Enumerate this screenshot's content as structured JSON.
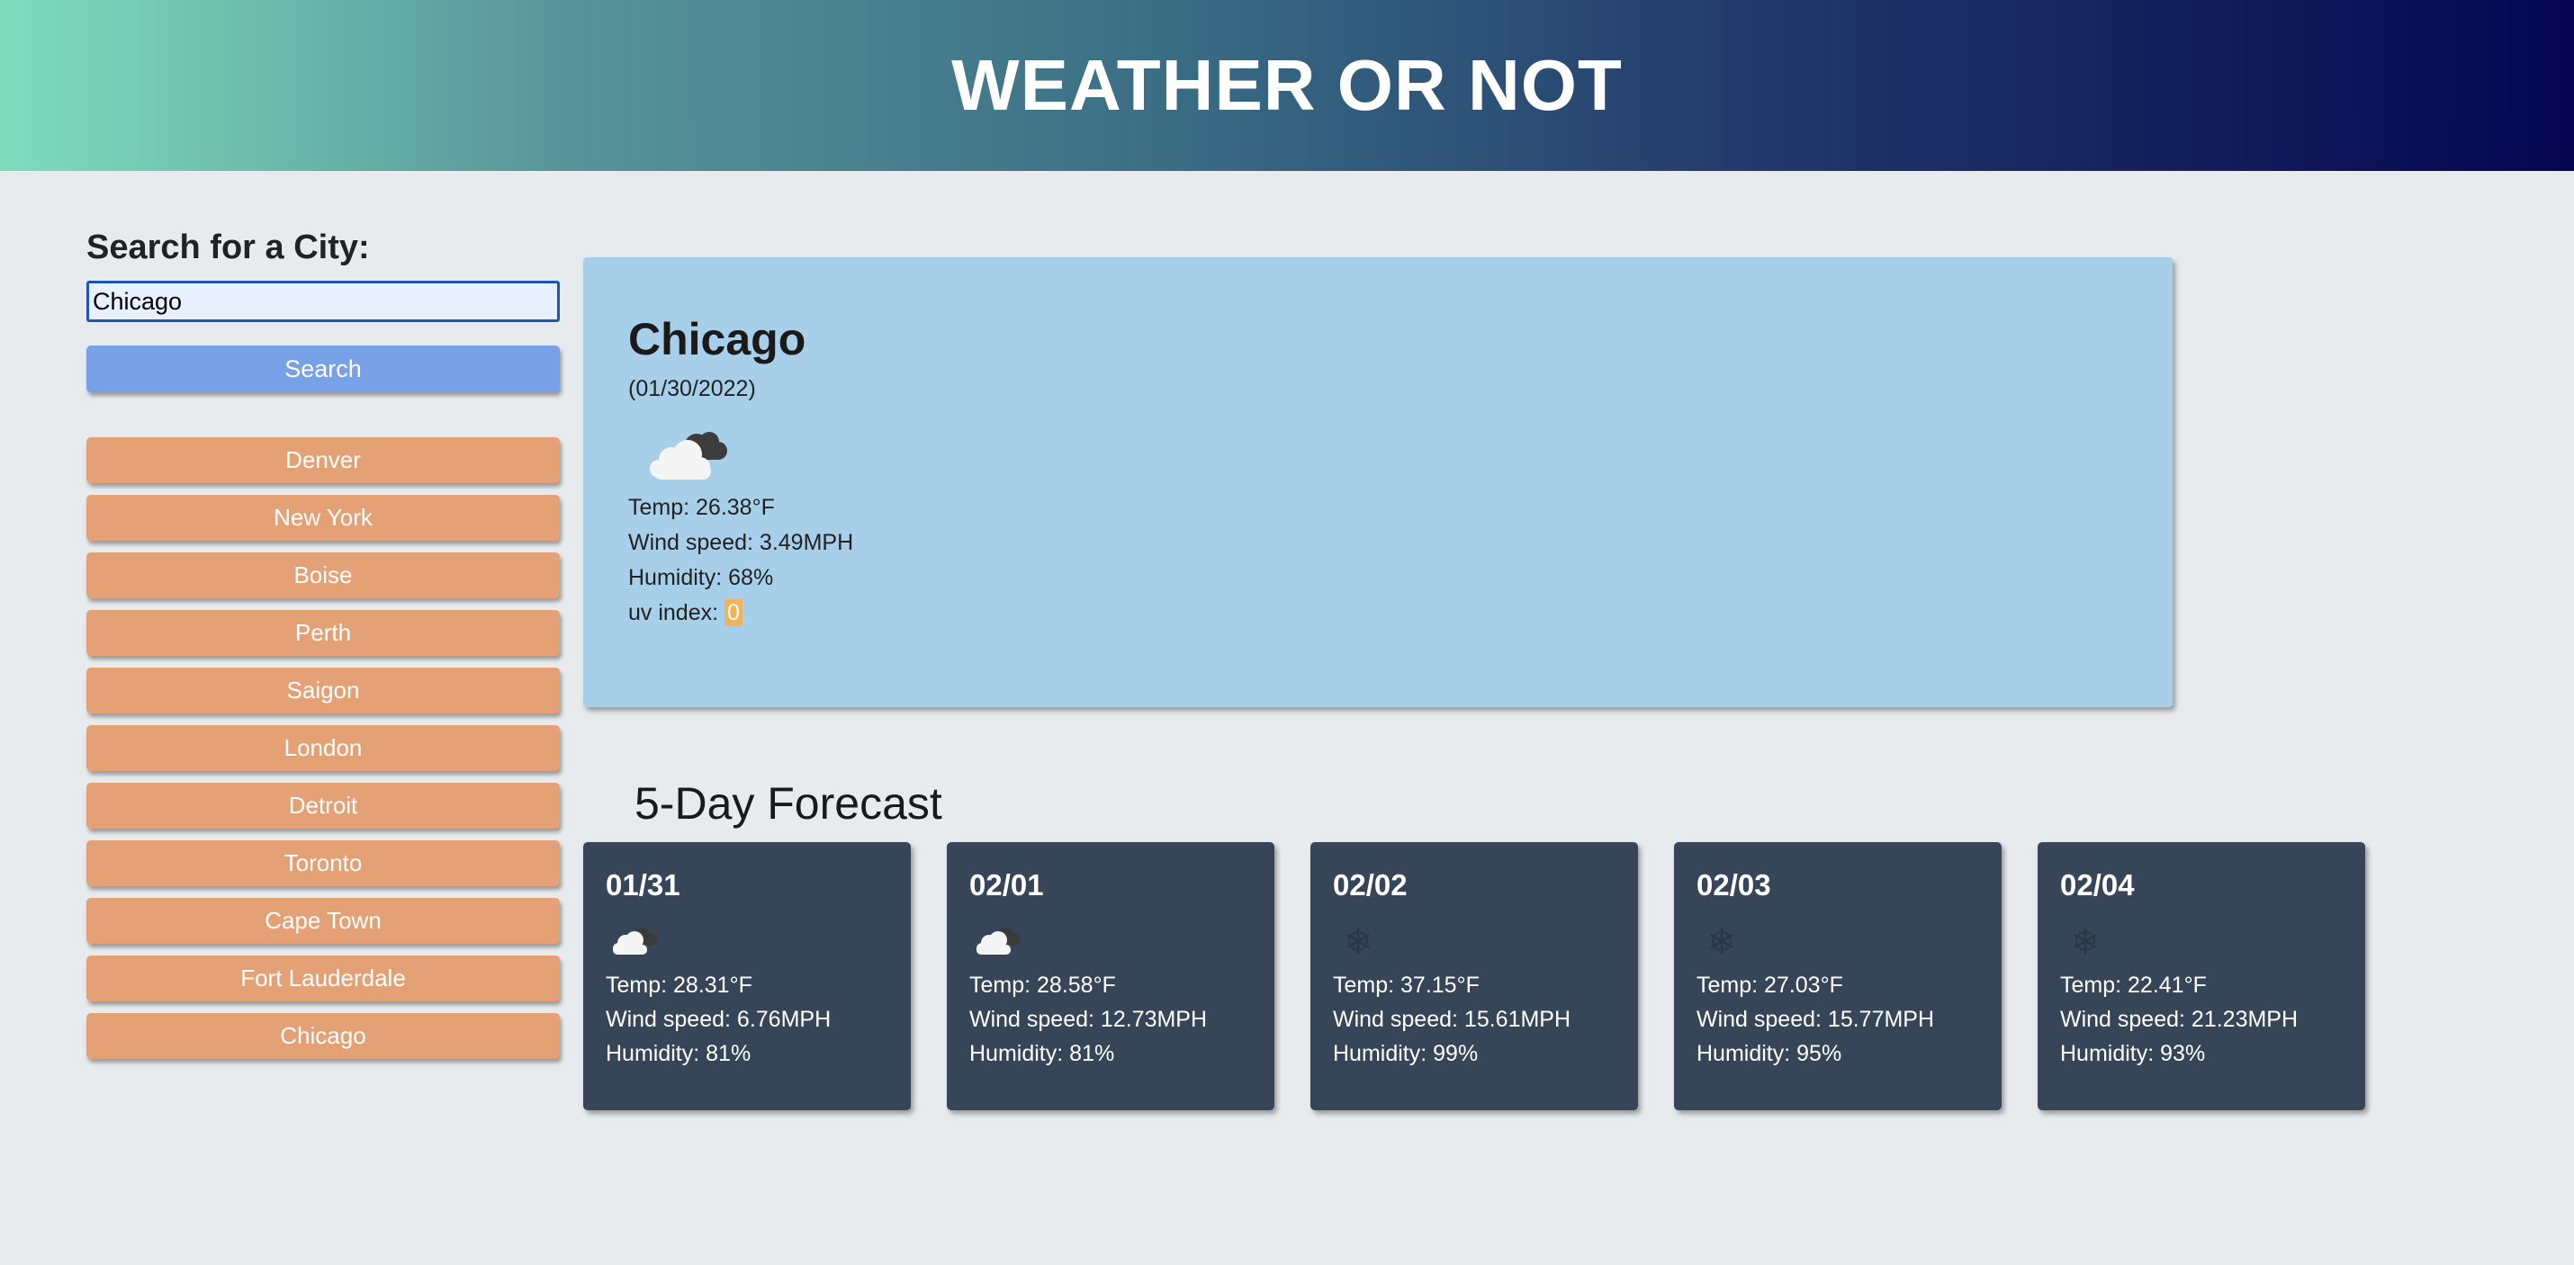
{
  "header": {
    "title": "WEATHER OR NOT"
  },
  "search": {
    "label": "Search for a City:",
    "value": "Chicago",
    "button_label": "Search"
  },
  "history": [
    "Denver",
    "New York",
    "Boise",
    "Perth",
    "Saigon",
    "London",
    "Detroit",
    "Toronto",
    "Cape Town",
    "Fort Lauderdale",
    "Chicago"
  ],
  "current": {
    "city": "Chicago",
    "date": "(01/30/2022)",
    "icon": "cloudy-icon",
    "temp": "Temp: 26.38°F",
    "wind": "Wind speed: 3.49MPH",
    "humidity": "Humidity: 68%",
    "uv_label": "uv index: ",
    "uv_value": "0"
  },
  "forecast": {
    "title": "5-Day Forecast",
    "days": [
      {
        "date": "01/31",
        "icon": "cloudy-icon",
        "temp": "Temp: 28.31°F",
        "wind": "Wind speed: 6.76MPH",
        "humidity": "Humidity: 81%"
      },
      {
        "date": "02/01",
        "icon": "cloudy-icon",
        "temp": "Temp: 28.58°F",
        "wind": "Wind speed: 12.73MPH",
        "humidity": "Humidity: 81%"
      },
      {
        "date": "02/02",
        "icon": "snow-icon",
        "temp": "Temp: 37.15°F",
        "wind": "Wind speed: 15.61MPH",
        "humidity": "Humidity: 99%"
      },
      {
        "date": "02/03",
        "icon": "snow-icon",
        "temp": "Temp: 27.03°F",
        "wind": "Wind speed: 15.77MPH",
        "humidity": "Humidity: 95%"
      },
      {
        "date": "02/04",
        "icon": "snow-icon",
        "temp": "Temp: 22.41°F",
        "wind": "Wind speed: 21.23MPH",
        "humidity": "Humidity: 93%"
      }
    ]
  },
  "colors": {
    "header_gradient_start": "#7fddbd",
    "header_gradient_end": "#050650",
    "search_button": "#78a1e7",
    "history_button": "#e4a175",
    "current_card": "#a7cfea",
    "forecast_card": "#364558",
    "uv_badge": "#f2b45a"
  }
}
